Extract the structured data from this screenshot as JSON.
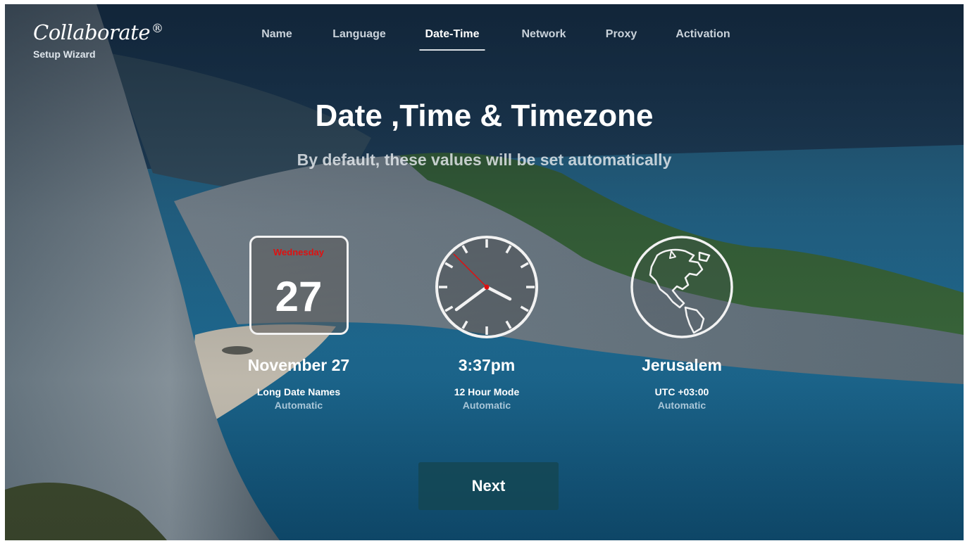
{
  "brand": {
    "logo": "Collaborate",
    "mark": "®",
    "subtitle": "Setup Wizard"
  },
  "nav": [
    {
      "label": "Name",
      "active": false
    },
    {
      "label": "Language",
      "active": false
    },
    {
      "label": "Date-Time",
      "active": true
    },
    {
      "label": "Network",
      "active": false
    },
    {
      "label": "Proxy",
      "active": false
    },
    {
      "label": "Activation",
      "active": false
    }
  ],
  "page": {
    "title": "Date ,Time & Timezone",
    "subtitle": "By default, these values will be set automatically"
  },
  "date": {
    "weekday": "Wednesday",
    "day": "27",
    "value": "November 27",
    "mode": "Long Date Names",
    "status": "Automatic"
  },
  "time": {
    "value": "3:37pm",
    "mode": "12 Hour Mode",
    "status": "Automatic"
  },
  "timezone": {
    "value": "Jerusalem",
    "offset": "UTC +03:00",
    "status": "Automatic"
  },
  "actions": {
    "next_label": "Next"
  },
  "colors": {
    "weekday": "#e01010",
    "second_hand": "#e01010",
    "next_button": "#14465a"
  },
  "icons": {
    "clock": "clock-icon",
    "globe": "globe-icon",
    "calendar": "calendar-icon"
  }
}
